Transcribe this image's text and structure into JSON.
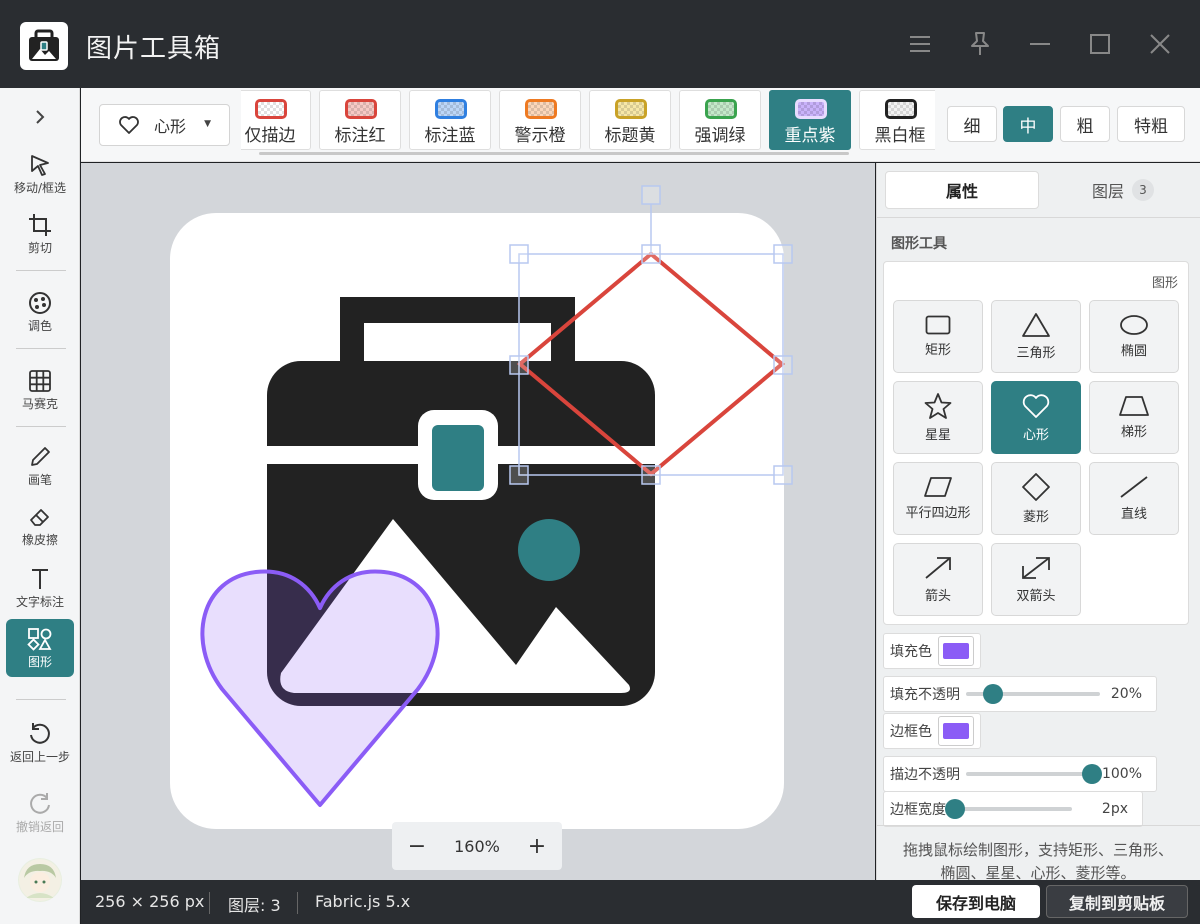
{
  "window": {
    "title": "图片工具箱",
    "logo_icon": "image-briefcase-icon",
    "controls": [
      "menu-icon",
      "pin-icon",
      "minimize-icon",
      "maximize-icon",
      "close-icon"
    ]
  },
  "left_toolbar": {
    "expand_icon": "chevron-right-icon",
    "items": [
      {
        "label": "移动/框选",
        "icon": "cursor-icon"
      },
      {
        "label": "剪切",
        "icon": "crop-icon"
      },
      {
        "label": "调色",
        "icon": "palette-icon"
      },
      {
        "label": "马赛克",
        "icon": "grid-icon"
      },
      {
        "label": "画笔",
        "icon": "pencil-icon"
      },
      {
        "label": "橡皮擦",
        "icon": "eraser-icon"
      },
      {
        "label": "文字标注",
        "icon": "text-icon"
      },
      {
        "label": "图形",
        "icon": "shapes-icon",
        "active": true
      },
      {
        "label": "返回上一步",
        "icon": "undo-icon"
      },
      {
        "label": "撤销返回",
        "icon": "redo-icon",
        "disabled": true
      }
    ],
    "avatar_icon": "user-avatar-icon"
  },
  "style_bar": {
    "shape_select": {
      "value": "心形",
      "icon": "heart-icon"
    },
    "presets": [
      {
        "label": "仅描边",
        "color": "#d9453c"
      },
      {
        "label": "标注红",
        "color": "#d9453c"
      },
      {
        "label": "标注蓝",
        "color": "#2f7fe0"
      },
      {
        "label": "警示橙",
        "color": "#ee7a22"
      },
      {
        "label": "标题黄",
        "color": "#c9a227"
      },
      {
        "label": "强调绿",
        "color": "#3aa34e"
      },
      {
        "label": "重点紫",
        "color": "#9b6cf0",
        "active": true
      },
      {
        "label": "黑白框",
        "color": "#222222"
      }
    ],
    "widths": [
      {
        "label": "细"
      },
      {
        "label": "中",
        "active": true
      },
      {
        "label": "粗"
      },
      {
        "label": "特粗"
      }
    ]
  },
  "canvas": {
    "zoom": "160%",
    "zoom_out": "−",
    "zoom_in": "+"
  },
  "right_panel": {
    "tabs": {
      "properties": "属性",
      "layers": "图层",
      "layer_count": "3"
    },
    "section_title": "图形工具",
    "shape_box_label": "图形",
    "shapes": [
      {
        "label": "矩形",
        "icon": "rectangle-icon"
      },
      {
        "label": "三角形",
        "icon": "triangle-icon"
      },
      {
        "label": "椭圆",
        "icon": "ellipse-icon"
      },
      {
        "label": "星星",
        "icon": "star-icon"
      },
      {
        "label": "心形",
        "icon": "heart-icon",
        "active": true
      },
      {
        "label": "梯形",
        "icon": "trapezoid-icon"
      },
      {
        "label": "平行四边形",
        "icon": "parallelogram-icon"
      },
      {
        "label": "菱形",
        "icon": "diamond-icon"
      },
      {
        "label": "直线",
        "icon": "line-icon"
      },
      {
        "label": "箭头",
        "icon": "arrow-icon"
      },
      {
        "label": "双箭头",
        "icon": "double-arrow-icon"
      }
    ],
    "fill_color_label": "填充色",
    "fill_color": "#8b5cf6",
    "fill_opacity_label": "填充不透明",
    "fill_opacity": "20%",
    "fill_opacity_fraction": 0.2,
    "border_color_label": "边框色",
    "border_color": "#8b5cf6",
    "stroke_opacity_label": "描边不透明",
    "stroke_opacity": "100%",
    "stroke_opacity_fraction": 1.0,
    "border_width_label": "边框宽度",
    "border_width": "2px",
    "help_text": "拖拽鼠标绘制图形，支持矩形、三角形、椭圆、星星、心形、菱形等。"
  },
  "status_bar": {
    "size": "256 × 256 px",
    "layers": "图层: 3",
    "engine": "Fabric.js 5.x",
    "save_button": "保存到电脑",
    "copy_button": "复制到剪贴板"
  },
  "colors": {
    "accent": "#2f7f84",
    "titlebar": "#2a2d31",
    "diamond_stroke": "#d9453c",
    "heart_stroke": "#8b5cf6"
  }
}
